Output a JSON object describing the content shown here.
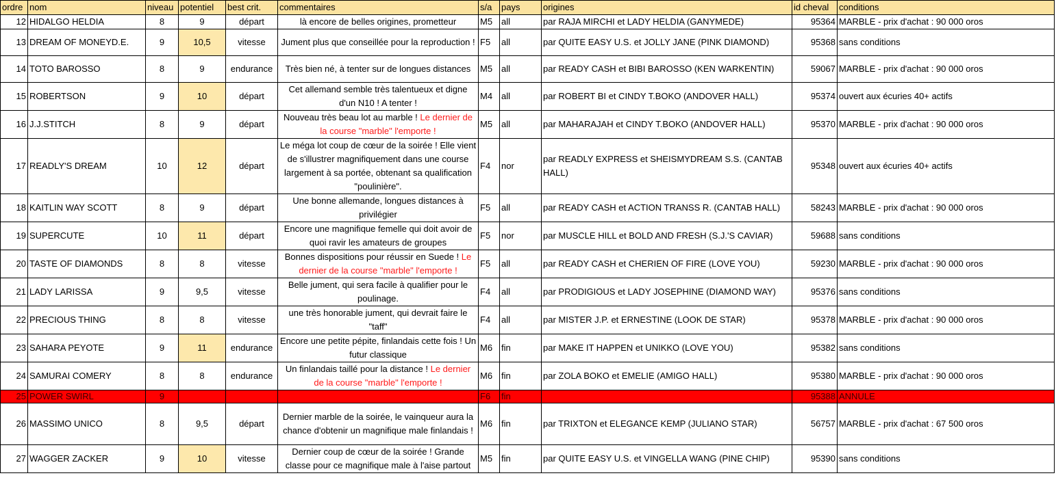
{
  "headers": {
    "ordre": "ordre",
    "nom": "nom",
    "niveau": "niveau",
    "potentiel": "potentiel",
    "best": "best crit.",
    "commentaires": "commentaires",
    "sa": "s/a",
    "pays": "pays",
    "origines": "origines",
    "id": "id cheval",
    "conditions": "conditions"
  },
  "rows": [
    {
      "ordre": "12",
      "nom": "HIDALGO HELDIA",
      "niveau": "8",
      "potentiel": "9",
      "best": "départ",
      "comment": "là encore de belles origines, prometteur",
      "comment_red": "",
      "sa": "M5",
      "pays": "all",
      "origines": "par  RAJA MIRCHI  et  LADY HELDIA   (GANYMEDE)",
      "id": "95364",
      "conditions": "MARBLE - prix d'achat : 90 000 oros",
      "highlight": false
    },
    {
      "ordre": "13",
      "nom": "DREAM OF MONEYD.E.",
      "niveau": "9",
      "potentiel": "10,5",
      "best": "vitesse",
      "comment": "Jument plus que conseillée pour la reproduction !",
      "comment_red": "",
      "sa": "F5",
      "pays": "all",
      "origines": "par  QUITE EASY U.S.  et  JOLLY JANE   (PINK DIAMOND)",
      "id": "95368",
      "conditions": "sans conditions",
      "highlight": true
    },
    {
      "ordre": "14",
      "nom": "TOTO BAROSSO",
      "niveau": "8",
      "potentiel": "9",
      "best": "endurance",
      "comment": "Très bien né, à tenter sur de longues distances",
      "comment_red": "",
      "sa": "M5",
      "pays": "all",
      "origines": "par  READY CASH  et  BIBI BAROSSO   (KEN WARKENTIN)",
      "id": "59067",
      "conditions": "MARBLE - prix d'achat : 90 000 oros",
      "highlight": false
    },
    {
      "ordre": "15",
      "nom": "ROBERTSON",
      "niveau": "9",
      "potentiel": "10",
      "best": "départ",
      "comment": "Cet allemand semble très talentueux et digne d'un N10 ! A tenter !",
      "comment_red": "",
      "sa": "M4",
      "pays": "all",
      "origines": "par  ROBERT BI  et  CINDY T.BOKO   (ANDOVER HALL)",
      "id": "95374",
      "conditions": "ouvert aux écuries 40+ actifs",
      "highlight": true
    },
    {
      "ordre": "16",
      "nom": "J.J.STITCH",
      "niveau": "8",
      "potentiel": "9",
      "best": "départ",
      "comment": "Nouveau très beau lot au marble ! ",
      "comment_red": "Le dernier de la course \"marble\" l'emporte !",
      "sa": "M5",
      "pays": "all",
      "origines": "par  MAHARAJAH  et  CINDY T.BOKO   (ANDOVER HALL)",
      "id": "95370",
      "conditions": "MARBLE - prix d'achat : 90 000 oros",
      "highlight": false
    },
    {
      "ordre": "17",
      "nom": "READLY'S DREAM",
      "niveau": "10",
      "potentiel": "12",
      "best": "départ",
      "comment": "Le méga lot coup de cœur de la soirée ! Elle vient de s'illustrer magnifiquement dans une course largement à sa portée, obtenant sa qualification \"poulinière\".",
      "comment_red": "",
      "sa": "F4",
      "pays": "nor",
      "origines": "par  READLY EXPRESS  et  SHEISMYDREAM S.S.   (CANTAB HALL)",
      "id": "95348",
      "conditions": "ouvert aux écuries 40+ actifs",
      "highlight": true
    },
    {
      "ordre": "18",
      "nom": "KAITLIN WAY SCOTT",
      "niveau": "8",
      "potentiel": "9",
      "best": "départ",
      "comment": "Une bonne allemande, longues distances à privilégier",
      "comment_red": "",
      "sa": "F5",
      "pays": "all",
      "origines": "par  READY CASH  et  ACTION TRANSS R.   (CANTAB HALL)",
      "id": "58243",
      "conditions": "MARBLE - prix d'achat : 90 000 oros",
      "highlight": false
    },
    {
      "ordre": "19",
      "nom": "SUPERCUTE",
      "niveau": "10",
      "potentiel": "11",
      "best": "départ",
      "comment": "Encore une magnifique femelle qui doit avoir de quoi ravir les amateurs de groupes",
      "comment_red": "",
      "sa": "F5",
      "pays": "nor",
      "origines": "par  MUSCLE HILL  et  BOLD AND FRESH   (S.J.'S CAVIAR)",
      "id": "59688",
      "conditions": "sans conditions",
      "highlight": true
    },
    {
      "ordre": "20",
      "nom": "TASTE OF DIAMONDS",
      "niveau": "8",
      "potentiel": "8",
      "best": "vitesse",
      "comment": "Bonnes dispositions pour réussir en Suede ! ",
      "comment_red": "Le dernier de la course \"marble\" l'emporte !",
      "sa": "F5",
      "pays": "all",
      "origines": "par  READY CASH  et  CHERIEN OF FIRE   (LOVE YOU)",
      "id": "59230",
      "conditions": "MARBLE - prix d'achat : 90 000 oros",
      "highlight": false
    },
    {
      "ordre": "21",
      "nom": "LADY LARISSA",
      "niveau": "9",
      "potentiel": "9,5",
      "best": "vitesse",
      "comment": "Belle jument, qui sera facile à qualifier pour le poulinage.",
      "comment_red": "",
      "sa": "F4",
      "pays": "all",
      "origines": "par  PRODIGIOUS  et  LADY JOSEPHINE   (DIAMOND WAY)",
      "id": "95376",
      "conditions": "sans conditions",
      "highlight": false
    },
    {
      "ordre": "22",
      "nom": "PRECIOUS THING",
      "niveau": "8",
      "potentiel": "8",
      "best": "vitesse",
      "comment": "une très honorable jument, qui devrait faire le \"taff\"",
      "comment_red": "",
      "sa": "F4",
      "pays": "all",
      "origines": "par  MISTER J.P.  et  ERNESTINE   (LOOK DE STAR)",
      "id": "95378",
      "conditions": "MARBLE - prix d'achat : 90 000 oros",
      "highlight": false
    },
    {
      "ordre": "23",
      "nom": "SAHARA PEYOTE",
      "niveau": "9",
      "potentiel": "11",
      "best": "endurance",
      "comment": "Encore une petite pépite, finlandais cette fois ! Un futur classique",
      "comment_red": "",
      "sa": "M6",
      "pays": "fin",
      "origines": "par  MAKE IT HAPPEN  et  UNIKKO   (LOVE YOU)",
      "id": "95382",
      "conditions": "sans conditions",
      "highlight": true
    },
    {
      "ordre": "24",
      "nom": "SAMURAI COMERY",
      "niveau": "8",
      "potentiel": "8",
      "best": "endurance",
      "comment": "Un finlandais taillé pour la distance  ! ",
      "comment_red": "Le dernier de la course \"marble\" l'emporte !",
      "sa": "M6",
      "pays": "fin",
      "origines": " par  ZOLA BOKO  et  EMELIE   (AMIGO HALL)",
      "id": "95380",
      "conditions": "MARBLE - prix d'achat : 90 000 oros",
      "highlight": false
    },
    {
      "ordre": "25",
      "nom": "POWER SWIRL",
      "niveau": "9",
      "potentiel": "",
      "best": "",
      "comment": "",
      "comment_red": "",
      "sa": "F6",
      "pays": "fin",
      "origines": "",
      "id": "95388",
      "conditions": "ANNULE",
      "highlight": false,
      "cancelled": true
    },
    {
      "ordre": "26",
      "nom": "MASSIMO UNICO",
      "niveau": "8",
      "potentiel": "9,5",
      "best": "départ",
      "comment": "Dernier marble de la soirée, le vainqueur aura la chance d'obtenir un magnifique male finlandais !",
      "comment_red": "",
      "sa": "M6",
      "pays": "fin",
      "origines": "par  TRIXTON  et  ELEGANCE KEMP   (JULIANO STAR)",
      "id": "56757",
      "conditions": "MARBLE - prix d'achat : 67 500 oros",
      "highlight": false
    },
    {
      "ordre": "27",
      "nom": "WAGGER ZACKER",
      "niveau": "9",
      "potentiel": "10",
      "best": "vitesse",
      "comment": "Dernier coup de cœur de la soirée ! Grande classe pour ce magnifique male à l'aise partout",
      "comment_red": "",
      "sa": "M5",
      "pays": "fin",
      "origines": "par  QUITE EASY U.S.  et  VINGELLA WANG   (PINE CHIP)",
      "id": "95390",
      "conditions": "sans conditions",
      "highlight": true
    }
  ]
}
